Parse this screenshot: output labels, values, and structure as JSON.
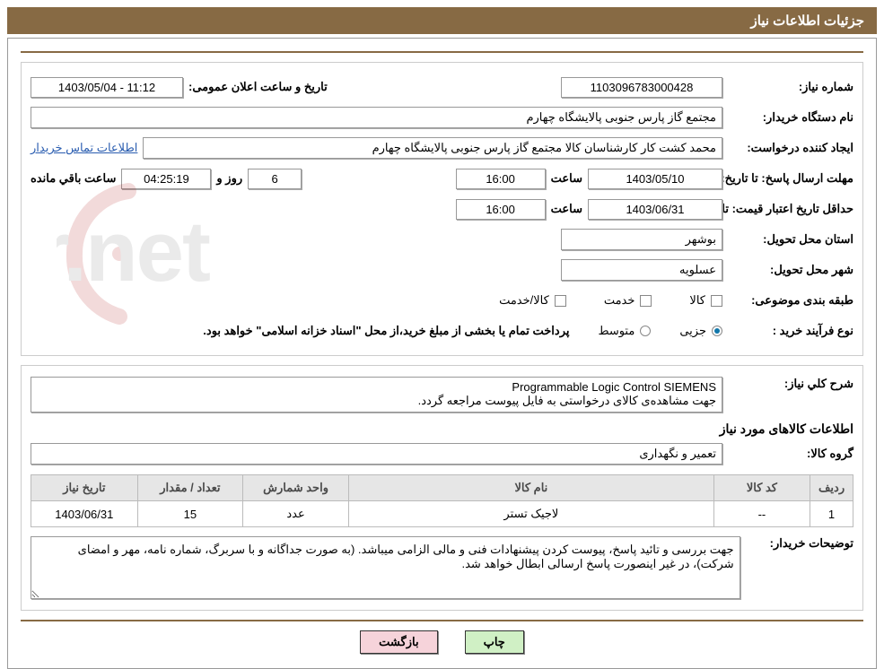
{
  "header_title": "جزئیات اطلاعات نیاز",
  "labels": {
    "need_no": "شماره نیاز:",
    "announce_dt": "تاریخ و ساعت اعلان عمومی:",
    "buyer_org": "نام دستگاه خریدار:",
    "requester": "ایجاد کننده درخواست:",
    "buyer_contact_link": "اطلاعات تماس خریدار",
    "answer_to": "مهلت ارسال پاسخ:",
    "to_date": "تا تاریخ:",
    "at_hour": "ساعت",
    "days_and": "روز و",
    "hours_remaining": "ساعت باقي مانده",
    "price_valid_to": "حداقل تاریخ اعتبار قیمت:",
    "delivery_province": "استان محل تحویل:",
    "delivery_city": "شهر محل تحویل:",
    "classification": "طبقه بندی موضوعی:",
    "purchase_type": "نوع فرآیند خرید :",
    "cls_goods": "کالا",
    "cls_service": "خدمت",
    "cls_goods_service": "کالا/خدمت",
    "radio_partial": "جزیی",
    "radio_medium": "متوسط",
    "purchase_note": "پرداخت تمام یا بخشی از مبلغ خرید،از محل \"اسناد خزانه اسلامی\" خواهد بود.",
    "need_desc": "شرح كلي نياز:",
    "goods_header": "اطلاعات کالاهای مورد نیاز",
    "goods_group": "گروه کالا:",
    "buyer_notes": "توضيحات خریدار:",
    "btn_print": "چاپ",
    "btn_back": "بازگشت"
  },
  "values": {
    "need_no": "1103096783000428",
    "announce_dt": "1403/05/04 - 11:12",
    "buyer_org": "مجتمع گاز پارس جنوبی  پالایشگاه چهارم",
    "requester": "محمد کشت کار کارشناسان کالا مجتمع گاز پارس جنوبی  پالایشگاه چهارم",
    "answer_to_date": "1403/05/10",
    "answer_to_time": "16:00",
    "days_left": "6",
    "hms_left": "04:25:19",
    "price_valid_date": "1403/06/31",
    "price_valid_time": "16:00",
    "delivery_province": "بوشهر",
    "delivery_city": "عسلویه",
    "need_desc": "Programmable Logic Control SIEMENS\nجهت مشاهده‌ی کالای درخواستی به فایل پیوست مراجعه گردد.",
    "goods_group": "تعمیر و نگهداری",
    "buyer_notes": "جهت بررسی و تائید پاسخ، پیوست کردن پیشنهادات فنی و مالی الزامی میباشد. (به صورت جداگانه و با سربرگ، شماره نامه، مهر و امضای شرکت)، در غیر اینصورت پاسخ ارسالی ابطال خواهد شد."
  },
  "table": {
    "headers": {
      "row": "ردیف",
      "code": "کد کالا",
      "name": "نام کالا",
      "unit": "واحد شمارش",
      "qty": "تعداد / مقدار",
      "date": "تاریخ نیاز"
    },
    "rows": [
      {
        "row": "1",
        "code": "--",
        "name": "لاجیک تستر",
        "unit": "عدد",
        "qty": "15",
        "date": "1403/06/31"
      }
    ]
  },
  "watermark_text": "AriaTender.net"
}
